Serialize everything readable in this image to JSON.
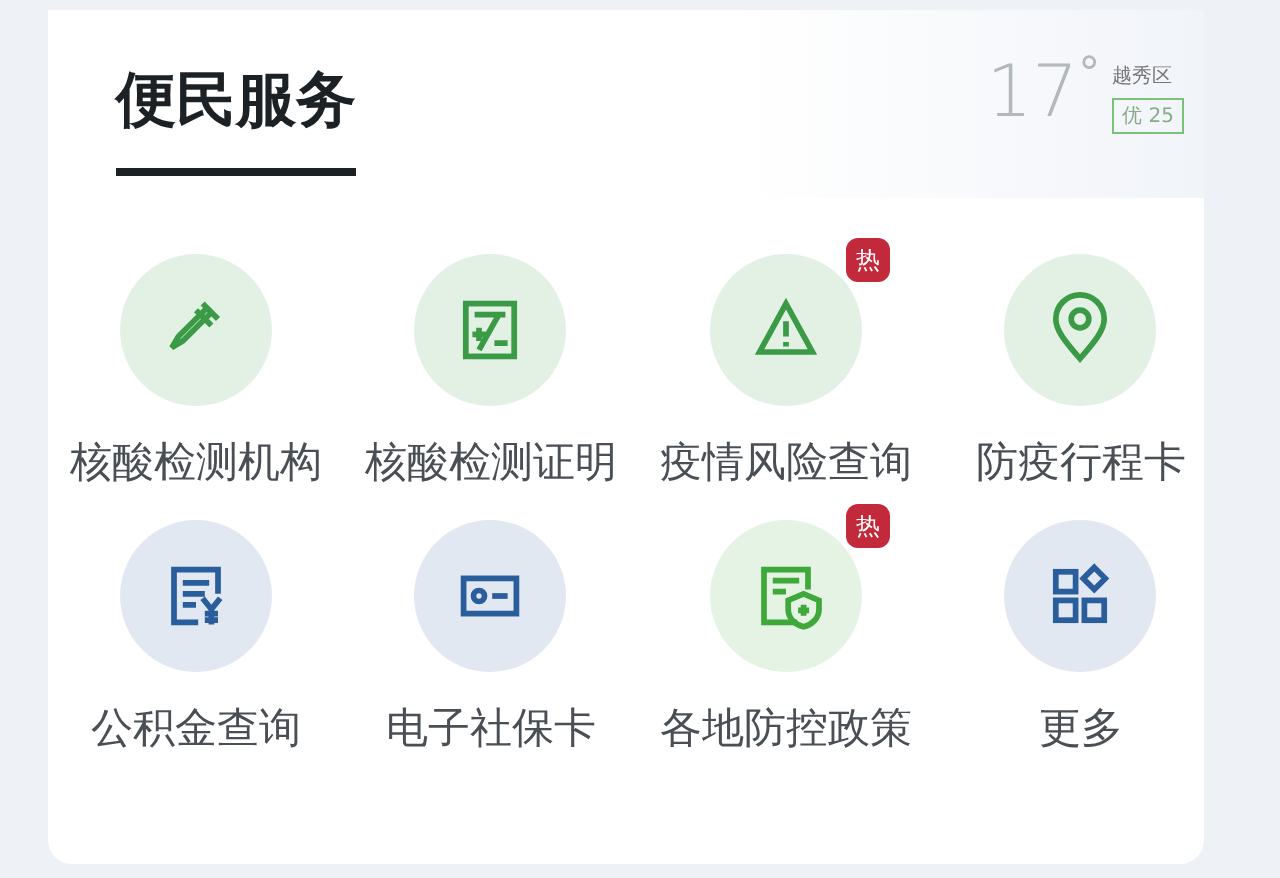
{
  "header": {
    "title": "便民服务",
    "selected": true
  },
  "weather": {
    "temperature": "17",
    "degree": "°",
    "district": "越秀区",
    "air_quality": "优 25"
  },
  "services": [
    {
      "label": "核酸检测机构",
      "color": "#3a9a46"
    },
    {
      "label": "核酸检测证明",
      "color": "#3a9a46"
    },
    {
      "label": "疫情风险查询",
      "badge": "热",
      "color": "#3a9a46"
    },
    {
      "label": "防疫行程卡",
      "color": "#3a9a46"
    },
    {
      "label": "公积金查询",
      "color": "#2a5d9c"
    },
    {
      "label": "电子社保卡",
      "color": "#2a5d9c"
    },
    {
      "label": "各地防控政策",
      "badge": "热",
      "color": "#3ea83a"
    },
    {
      "label": "更多",
      "color": "#2a5d9c"
    }
  ]
}
